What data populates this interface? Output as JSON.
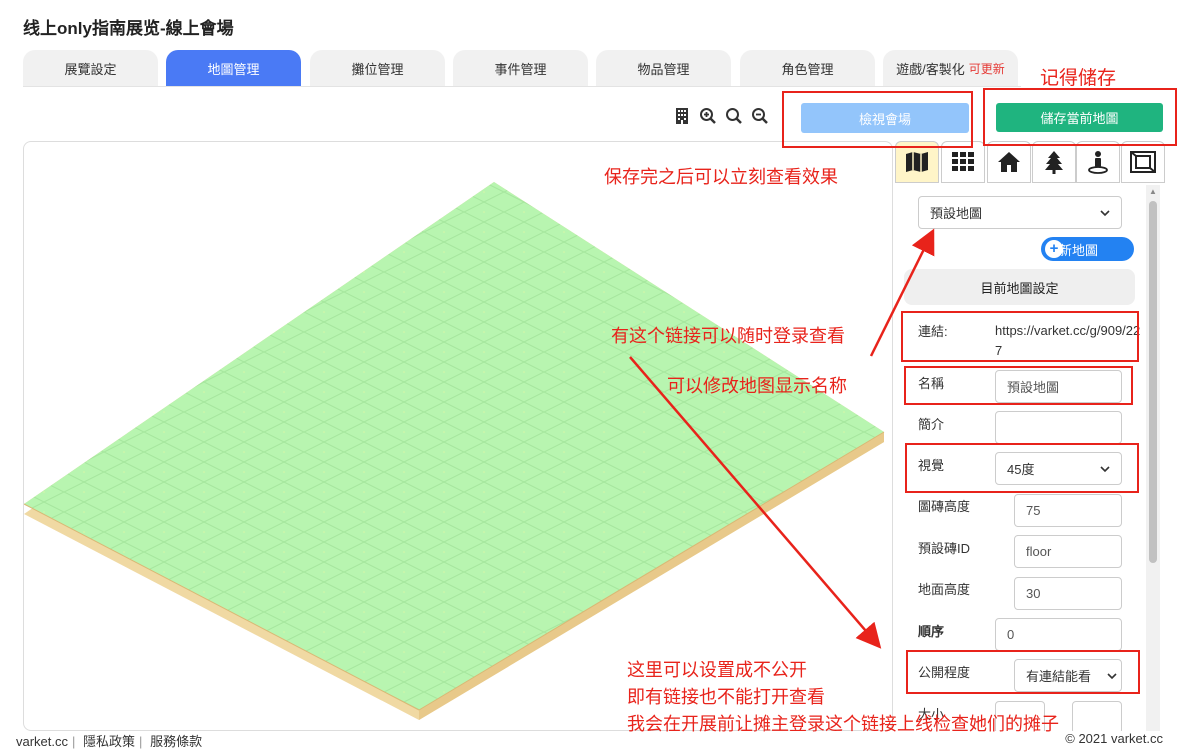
{
  "page": {
    "title": "线上only指南展览-線上會場"
  },
  "tabs": [
    {
      "label": "展覽設定"
    },
    {
      "label": "地圖管理",
      "active": true
    },
    {
      "label": "攤位管理"
    },
    {
      "label": "事件管理"
    },
    {
      "label": "物品管理"
    },
    {
      "label": "角色管理"
    },
    {
      "label": "遊戲/客製化",
      "badge": "可更新"
    }
  ],
  "toolbar": {
    "icons": [
      "building-icon",
      "zoom-in-icon",
      "search-icon",
      "zoom-out-icon"
    ],
    "view_label": "檢視會場",
    "save_label": "儲存當前地圖"
  },
  "panel": {
    "tab_icons": [
      "map-icon",
      "grid-icon",
      "home-icon",
      "tree-icon",
      "person-pin-icon",
      "frame-icon"
    ],
    "map_select": "預設地圖",
    "new_map_label": "新地圖",
    "section_title": "目前地圖設定",
    "link_label": "連結:",
    "link_value": "https://varket.cc/g/909/227",
    "name_label": "名稱",
    "name_value": "預設地圖",
    "intro_label": "簡介",
    "intro_value": "",
    "view_label": "視覺",
    "view_value": "45度",
    "tile_height_label": "圖磚高度",
    "tile_height_value": "75",
    "default_tile_label": "預設磚ID",
    "default_tile_value": "floor",
    "ground_height_label": "地面高度",
    "ground_height_value": "30",
    "order_label": "順序",
    "order_value": "0",
    "public_label": "公開程度",
    "public_value": "有連結能看",
    "size_label": "大小"
  },
  "annotations": {
    "remember_save": "记得储存",
    "view_after_save": "保存完之后可以立刻查看效果",
    "link_note": "有这个链接可以随时登录查看",
    "rename_note": "可以修改地图显示名称",
    "private_note_1": "这里可以设置成不公开",
    "private_note_2": "即有链接也不能打开查看",
    "private_note_3": "我会在开展前让摊主登录这个链接上线检查她们的摊子",
    "color": "#e8231b"
  },
  "footer": {
    "site": "varket.cc",
    "privacy": "隱私政策",
    "terms": "服務條款",
    "copyright": "© 2021 varket.cc"
  },
  "colors": {
    "active_tab": "#4a7af5",
    "view_button": "#93c5fb",
    "save_button": "#1fb47f",
    "new_map_button": "#2382f2",
    "grass_tile": "#b8f5b0",
    "soil_side": "#f0d9a3"
  }
}
